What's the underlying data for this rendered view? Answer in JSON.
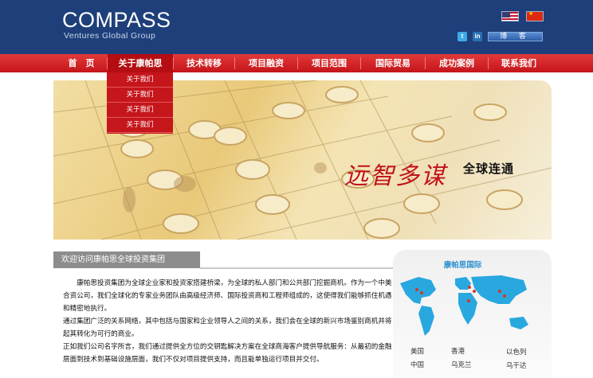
{
  "header": {
    "logo_main": "COMPASS",
    "logo_sub": "Ventures Global Group",
    "blog_label": "博 客",
    "flag_icons": [
      "us-flag-icon",
      "china-flag-icon"
    ],
    "social_icons": [
      "twitter-icon",
      "linkedin-icon"
    ]
  },
  "nav": {
    "items": [
      "首　页",
      "关于康帕思",
      "技术转移",
      "项目融资",
      "项目范围",
      "国际贸易",
      "成功案例",
      "联系我们"
    ],
    "active_index": 1
  },
  "dropdown": {
    "items": [
      "关于我们",
      "关于我们",
      "关于我们",
      "关于我们"
    ]
  },
  "banner": {
    "slogan": "远智多谋",
    "tagline": "全球连通"
  },
  "welcome": {
    "title": "欢迎访问康帕思全球投资集团",
    "paragraphs": [
      "　　康帕思投资集团为全球企业家和投资家搭建桥梁，为全球的私人部门和公共部门挖掘商机。作为一个中美合资公司，我们全球化的专家业务团队由高级经济师、国际投资商和工程师组成的，这使得我们能够抓住机遇和精密地执行。",
      "通过集团广泛的关系网络，其中包括与国家和企业领导人之间的关系，我们会在全球的新兴市场鉴别商机并将起其转化为可行的商业。",
      "正如我们公司名字所言，我们通过提供全方位的交钥匙解决方案在全球商海客户提供导航服务：从最初的金融层面到技术到基础设施层面，我们不仅对项目提供支持，而且能单独运行项目并交付。"
    ]
  },
  "partners": {
    "title": "康帕思国际",
    "countries": [
      "美国",
      "香港",
      "以色列",
      "中国",
      "乌克兰",
      "乌干达"
    ]
  },
  "colors": {
    "header_bg": "#1e3f7a",
    "nav_red": "#d42328",
    "map_blue": "#29a8e0",
    "slogan_red": "#c1121a"
  }
}
